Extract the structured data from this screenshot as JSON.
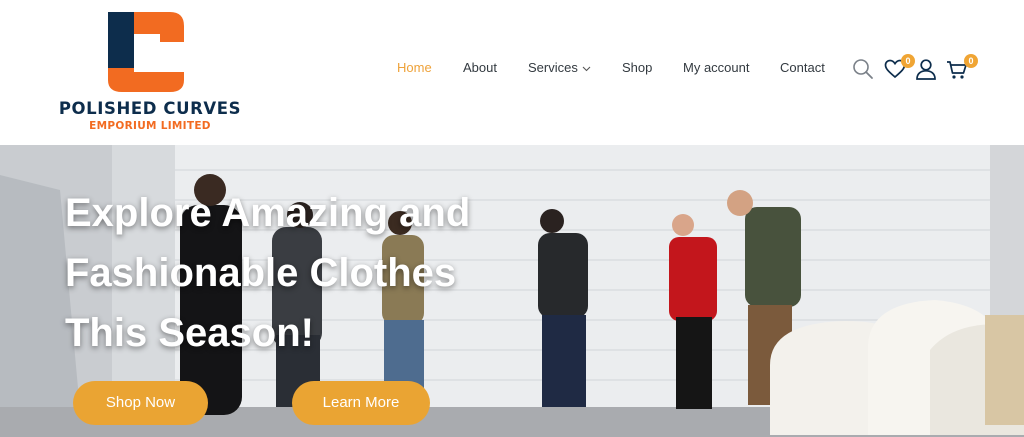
{
  "brand": {
    "name": "POLISHED CURVES",
    "sub": "EMPORIUM LIMITED",
    "colors": {
      "navy": "#0d2d4c",
      "orange": "#f26b21"
    }
  },
  "nav": {
    "items": [
      {
        "label": "Home",
        "active": true
      },
      {
        "label": "About"
      },
      {
        "label": "Services",
        "has_dropdown": true
      },
      {
        "label": "Shop"
      },
      {
        "label": "My account"
      },
      {
        "label": "Contact"
      }
    ],
    "accent": "#eea23a"
  },
  "header_icons": {
    "search": "search-icon",
    "wishlist": "heart-icon",
    "wishlist_count": "0",
    "account": "user-icon",
    "cart": "cart-icon",
    "cart_count": "0"
  },
  "hero": {
    "headline_lines": [
      "Explore Amazing and",
      "Fashionable Clothes",
      "This Season!"
    ],
    "buttons": {
      "shop_now": "Shop Now",
      "learn_more": "Learn More"
    },
    "button_color": "#eaa433"
  }
}
